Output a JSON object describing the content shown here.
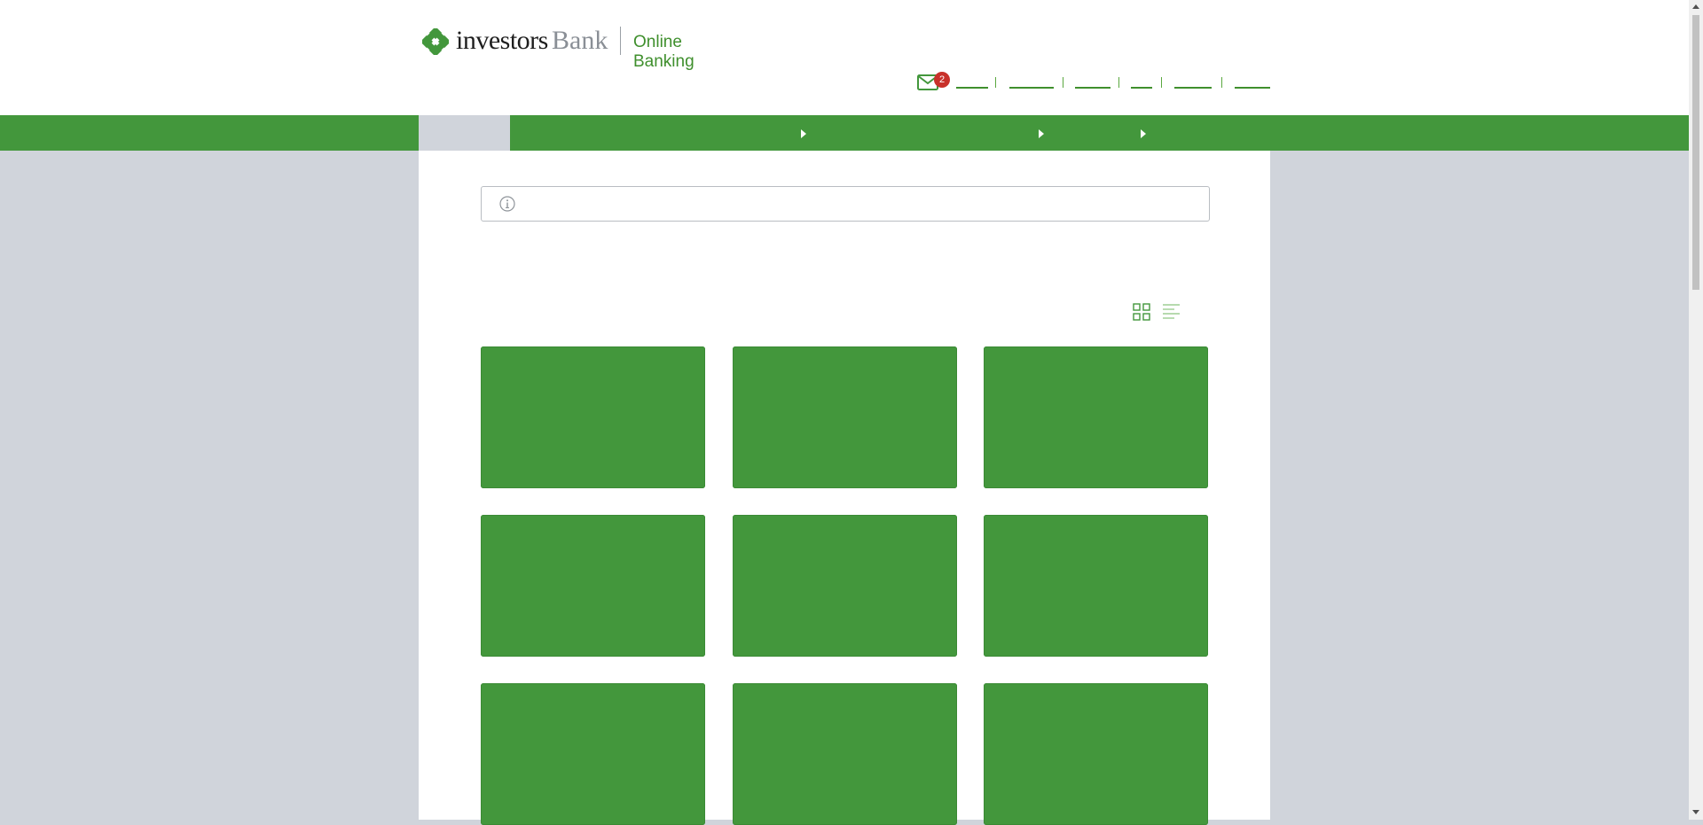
{
  "header": {
    "logo": {
      "word_primary": "investors",
      "word_secondary": "Bank",
      "subtitle": "Online Banking"
    },
    "messages": {
      "icon": "mail-icon",
      "unread_count": "2"
    }
  },
  "colors": {
    "brand_green": "#43973c",
    "text_green": "#3f8f2d",
    "background_gray": "#d0d4db",
    "badge_red": "#c8312a"
  },
  "notice": {
    "icon": "info-icon"
  },
  "view_toggle": {
    "options": [
      "grid-view-icon",
      "list-view-icon"
    ]
  }
}
